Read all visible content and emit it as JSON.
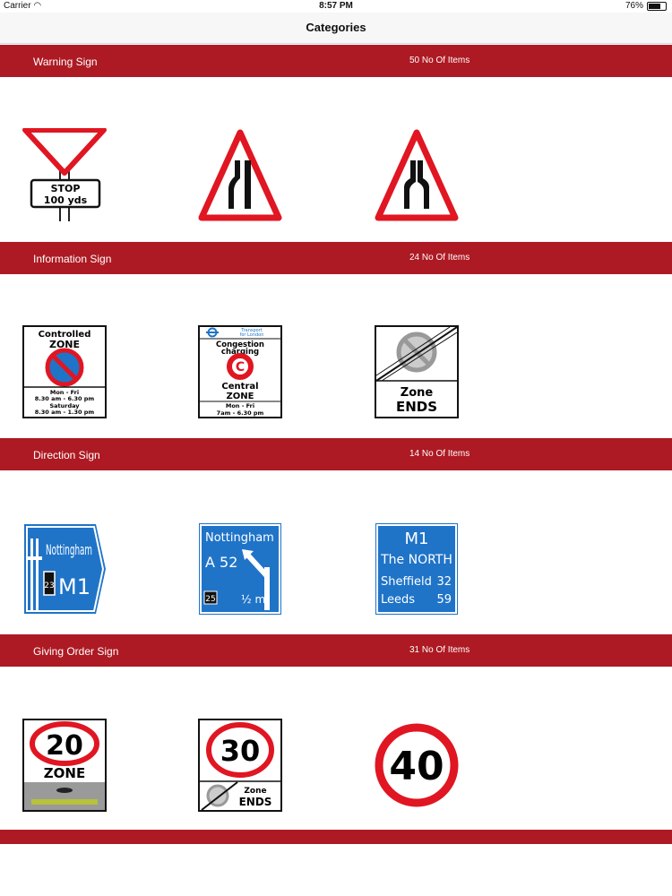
{
  "status_bar": {
    "carrier": "Carrier",
    "time": "8:57 PM",
    "battery": "76%"
  },
  "nav": {
    "title": "Categories"
  },
  "sections": [
    {
      "name": "Warning Sign",
      "count": "50 No Of Items",
      "signs": [
        {
          "text": [
            "STOP",
            "100 yds"
          ]
        },
        {},
        {}
      ]
    },
    {
      "name": "Information Sign",
      "count": "24 No Of Items",
      "signs": [
        {
          "text": [
            "Controlled",
            "ZONE",
            "Mon - Fri",
            "8.30 am - 6.30 pm",
            "Saturday",
            "8.30 am - 1.30 pm"
          ]
        },
        {
          "text": [
            "Transport",
            "for London",
            "Congestion",
            "charging",
            "C",
            "Central",
            "ZONE",
            "Mon - Fri",
            "7am - 6.30 pm"
          ]
        },
        {
          "text": [
            "Zone",
            "ENDS"
          ]
        }
      ]
    },
    {
      "name": "Direction Sign",
      "count": "14 No Of Items",
      "signs": [
        {
          "text": [
            "Nottingham",
            "23",
            "M1"
          ]
        },
        {
          "text": [
            "Nottingham",
            "A 52",
            "25",
            "½ m"
          ]
        },
        {
          "text": [
            "M1",
            "The NORTH",
            "Sheffield",
            "32",
            "Leeds",
            "59"
          ]
        }
      ]
    },
    {
      "name": "Giving Order Sign",
      "count": "31 No Of Items",
      "signs": [
        {
          "text": [
            "20",
            "ZONE"
          ]
        },
        {
          "text": [
            "30",
            "Zone",
            "ENDS"
          ]
        },
        {
          "text": [
            "40"
          ]
        }
      ]
    }
  ],
  "colors": {
    "header": "#ad1a23",
    "sign_red": "#e01622",
    "sign_blue": "#1f74c8"
  }
}
